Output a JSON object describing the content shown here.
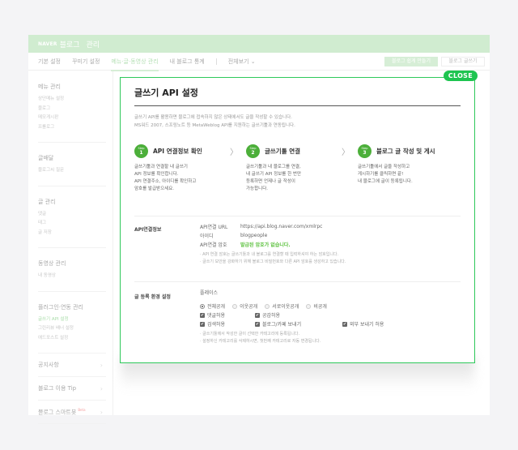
{
  "header": {
    "naver_logo": "NAVER",
    "blog": "블로그",
    "manage": "관리"
  },
  "nav": {
    "tabs": [
      {
        "label": "기본 설정",
        "active": false
      },
      {
        "label": "꾸미기 설정",
        "active": false
      },
      {
        "label": "메뉴·글·동영상 관리",
        "active": true
      },
      {
        "label": "내 블로그 통계",
        "active": false
      }
    ],
    "view_all": "전체보기",
    "view_all_icon": "chevron-down",
    "easy_blog_button": "블로그 쉽게 만들기",
    "write_button": "블로그 글쓰기"
  },
  "sidebar": {
    "groups": [
      {
        "title": "메뉴 관리",
        "items": [
          {
            "label": "상단메뉴 설정"
          },
          {
            "label": "블로그"
          },
          {
            "label": "메모게시판"
          },
          {
            "label": "프롤로그"
          }
        ]
      },
      {
        "title": "글배달",
        "items": [
          {
            "label": "블로그씨 질문"
          }
        ]
      },
      {
        "title": "글 관리",
        "items": [
          {
            "label": "댓글"
          },
          {
            "label": "태그"
          },
          {
            "label": "글 저장"
          }
        ]
      },
      {
        "title": "동영상 관리",
        "items": [
          {
            "label": "내 동영상"
          }
        ]
      },
      {
        "title": "플러그인·연동 관리",
        "items": [
          {
            "label": "글쓰기 API 설정",
            "active": true
          },
          {
            "label": "그린리뷰 배너 설정"
          },
          {
            "label": "애드포스트 설정"
          }
        ]
      }
    ],
    "links": [
      {
        "label": "공지사항"
      },
      {
        "label": "블로그 이용 Tip"
      },
      {
        "label": "블로그 스마트봇",
        "badge": "Beta"
      }
    ]
  },
  "modal": {
    "close_label": "CLOSE",
    "title": "글쓰기 API 설정",
    "description": [
      "글쓰기 API를 활용하면 블로그에 접속하지 않은 상태에서도 글을 작성할 수 있습니다.",
      "MS워드 2007, 스프링노트 등 MetaWeblog API를 지원하는 글쓰기툴과 연동됩니다."
    ],
    "steps": [
      {
        "badge_word": "Step",
        "number": "1",
        "title": "API 연결정보 확인",
        "lines": [
          "글쓰기툴과 연결할 내 글쓰기",
          "API 정보를 확인합니다.",
          "API 연결주소, 아이디를 확인하고",
          "암호를 발급받으세요."
        ]
      },
      {
        "badge_word": "Step",
        "number": "2",
        "title": "글쓰기툴 연결",
        "lines": [
          "글쓰기툴과 내 블로그를 연결,",
          "내 글쓰기 API 정보를 한 번만",
          "등록하면 언제나 글 작성이",
          "가능합니다."
        ]
      },
      {
        "badge_word": "Step",
        "number": "3",
        "title": "블로그 글 작성 및 게시",
        "lines": [
          "글쓰기툴에서 글을 작성하고",
          "게시하기를 클릭하면 끝!",
          "내 블로그에 글이 등록됩니다."
        ]
      }
    ],
    "api_info": {
      "section_label": "API연결정보",
      "rows": [
        {
          "key": "API연결 URL",
          "value": "https://api.blog.naver.com/xmlrpc"
        },
        {
          "key": "아이디",
          "value": "blogpeople"
        },
        {
          "key": "API연결 암호",
          "value": "발급된 암호가 없습니다."
        }
      ],
      "notes": [
        "· API 연결 암호는 글쓰기툴과 내 블로그를 연결할 때 입력하셔야 하는 암호입니다.",
        "· 글쓰기 보안을 강화하기 위해 블로그 비밀번호와 다른 API 암호를 생성하고 있습니다."
      ]
    },
    "post_settings": {
      "section_label": "글 등록 환경 설정",
      "category": "플레이스",
      "visibility_options": [
        {
          "label": "전체공개",
          "selected": true
        },
        {
          "label": "이웃공개",
          "selected": false
        },
        {
          "label": "서로이웃공개",
          "selected": false
        },
        {
          "label": "비공개",
          "selected": false
        }
      ],
      "checkboxes": [
        {
          "label": "댓글허용",
          "checked": true
        },
        {
          "label": "공감허용",
          "checked": true
        },
        {
          "label": "검색허용",
          "checked": true
        },
        {
          "label": "블로그/카페 보내기",
          "checked": true
        },
        {
          "label": "외부 보내기 허용",
          "checked": true
        }
      ],
      "notes": [
        "· 글쓰기툴에서 작성한 글이 선택한 카테고리에 등록됩니다.",
        "· 설정하신 카테고리를 삭제하시면, 첫번째 카테고리로 자동 변경됩니다."
      ]
    }
  },
  "colors": {
    "accent": "#1ec450",
    "header_bg": "#d0ecd0",
    "step_badge": "#4caf3a",
    "password_status": "#5cc13e"
  }
}
